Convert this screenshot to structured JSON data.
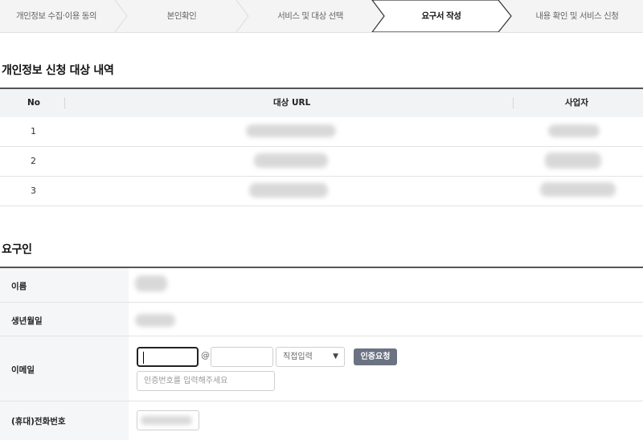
{
  "stepper": {
    "steps": [
      {
        "label": "개인정보 수집·이용 동의",
        "active": false
      },
      {
        "label": "본인확인",
        "active": false
      },
      {
        "label": "서비스 및 대상 선택",
        "active": false
      },
      {
        "label": "요구서 작성",
        "active": true
      },
      {
        "label": "내용 확인 및 서비스 신청",
        "active": false
      }
    ]
  },
  "targets": {
    "title": "개인정보 신청 대상 내역",
    "headers": {
      "no": "No",
      "url": "대상 URL",
      "company": "사업자"
    },
    "rows": [
      {
        "no": "1"
      },
      {
        "no": "2"
      },
      {
        "no": "3"
      }
    ]
  },
  "requester": {
    "title": "요구인",
    "labels": {
      "name": "이름",
      "birth": "생년월일",
      "email": "이메일",
      "phone": "(휴대)전화번호"
    },
    "email": {
      "id_value": "",
      "at": "@",
      "domain_value": "",
      "domain_select": "직접입력",
      "verify_button": "인증요청",
      "code_placeholder": "인증번호를 입력해주세요"
    }
  },
  "colors": {
    "header_rule": "#555555",
    "label_bg": "#f5f6f8",
    "button": "#6b7383"
  }
}
